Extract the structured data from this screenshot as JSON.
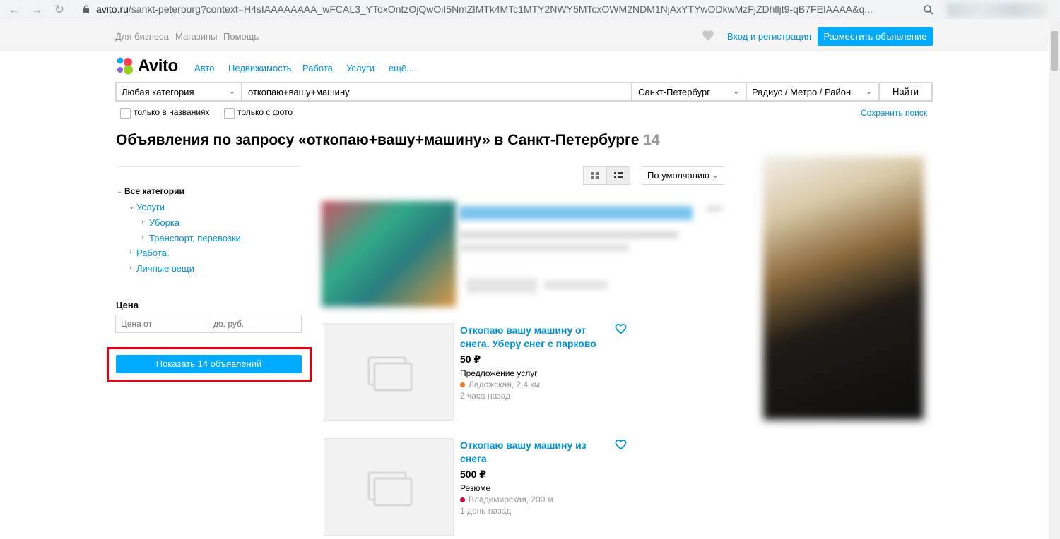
{
  "browser": {
    "url_host": "avito.ru",
    "url_path": "/sankt-peterburg?context=H4sIAAAAAAAA_wFCAL3_YToxOntzOjQwOiI5NmZlMTk4MTc1MTY2NWY5MTcxOWM2NDM1NjAxYTYwODkwMzFjZDhlljt9-qB7FEIAAAA&q..."
  },
  "topbar": {
    "for_business": "Для бизнеса",
    "shops": "Магазины",
    "help": "Помощь",
    "login": "Вход и регистрация",
    "post_ad": "Разместить объявление"
  },
  "logo": {
    "text": "Avito"
  },
  "nav": {
    "auto": "Авто",
    "realty": "Недвижимость",
    "jobs": "Работа",
    "services": "Услуги",
    "more": "ещё..."
  },
  "search": {
    "category": "Любая категория",
    "query": "откопаю+вашу+машину",
    "city": "Санкт-Петербург",
    "radius": "Радиус / Метро / Район",
    "submit": "Найти",
    "only_titles": "только в названиях",
    "only_photo": "только с фото",
    "save": "Сохранить поиск"
  },
  "page": {
    "title": "Объявления по запросу «откопаю+вашу+машину» в Санкт-Петербурге",
    "count": "14"
  },
  "filters": {
    "all_categories": "Все категории",
    "services": "Услуги",
    "cleaning": "Уборка",
    "transport": "Транспорт, перевозки",
    "jobs": "Работа",
    "personal": "Личные вещи",
    "price_label": "Цена",
    "price_from_placeholder": "Цена от",
    "price_to_placeholder": "до, руб.",
    "show_button": "Показать 14 объявлений"
  },
  "view": {
    "sort": "По умолчанию"
  },
  "items": [
    {
      "title": "Откопаю вашу машину от снега. Уберу снег с парково",
      "price": "50 ₽",
      "category": "Предложение услуг",
      "metro": "Ладожская, 2,4 км",
      "metro_color": "#f07d22",
      "time": "2 часа назад"
    },
    {
      "title": "Откопаю вашу машину из снега",
      "price": "500 ₽",
      "category": "Резюме",
      "metro": "Владимирская, 200 м",
      "metro_color": "#d6083b",
      "time": "1 день назад"
    }
  ],
  "colors": {
    "accent": "#00aaff",
    "link": "#0091d9",
    "highlight": "#e3000f"
  }
}
